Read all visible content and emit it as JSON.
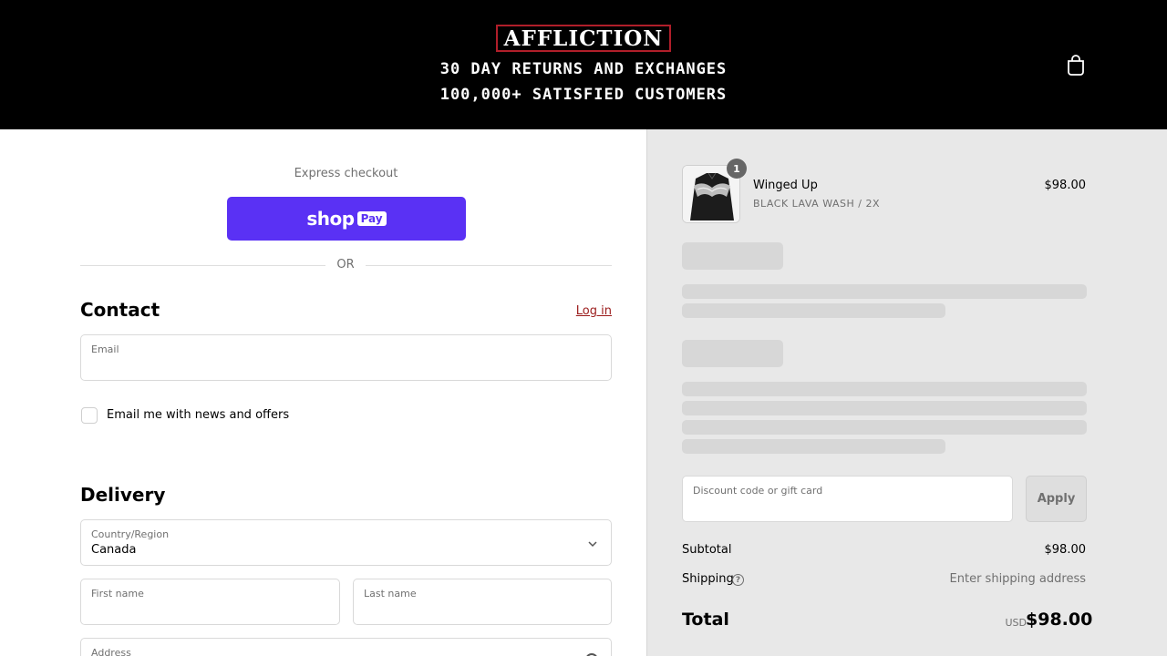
{
  "header": {
    "logo_text": "AFFLICTION",
    "tagline_1": "30 DAY RETURNS AND EXCHANGES",
    "tagline_2": "100,000+ SATISFIED CUSTOMERS",
    "cart_icon": "shopping-bag-icon",
    "brand_color": "#b01e2a"
  },
  "express": {
    "label": "Express checkout",
    "shoppay_text": "shop",
    "shoppay_pay": "Pay",
    "shoppay_color": "#5a31f4",
    "or_text": "OR"
  },
  "contact": {
    "title": "Contact",
    "login_label": "Log in",
    "email_label": "Email",
    "email_value": "",
    "newsletter_label": "Email me with news and offers",
    "newsletter_checked": false
  },
  "delivery": {
    "title": "Delivery",
    "country_label": "Country/Region",
    "country_value": "Canada",
    "first_name_label": "First name",
    "last_name_label": "Last name",
    "address_label": "Address"
  },
  "order": {
    "item": {
      "name": "Winged Up",
      "variant": "BLACK LAVA WASH / 2X",
      "price": "$98.00",
      "quantity": "1"
    },
    "discount_label": "Discount code or gift card",
    "apply_label": "Apply",
    "subtotal_label": "Subtotal",
    "subtotal_value": "$98.00",
    "shipping_label": "Shipping",
    "shipping_value": "Enter shipping address",
    "total_label": "Total",
    "total_currency": "USD",
    "total_value": "$98.00"
  }
}
